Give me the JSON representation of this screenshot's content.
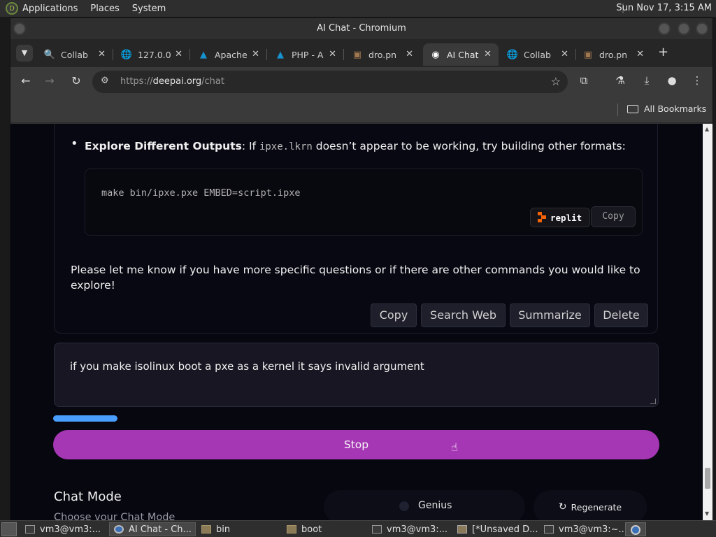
{
  "top_panel": {
    "menus": [
      "Applications",
      "Places",
      "System"
    ],
    "clock": "Sun Nov 17,  3:15 AM"
  },
  "window": {
    "title": "AI Chat - Chromium"
  },
  "tabs": [
    {
      "label": "Collab",
      "icon": "search-icon",
      "active": false
    },
    {
      "label": "127.0.0",
      "icon": "globe-icon",
      "active": false
    },
    {
      "label": "Apache",
      "icon": "arch-logo-icon",
      "active": false
    },
    {
      "label": "PHP - A",
      "icon": "arch-logo-icon",
      "active": false
    },
    {
      "label": "dro.pn",
      "icon": "image-icon",
      "active": false
    },
    {
      "label": "AI Chat",
      "icon": "chromium-icon",
      "active": true
    },
    {
      "label": "Collab",
      "icon": "globe-icon",
      "active": false
    },
    {
      "label": "dro.pn",
      "icon": "image-icon",
      "active": false
    }
  ],
  "toolbar": {
    "url_prefix": "https://",
    "url_host": "deepai.org",
    "url_path": "/chat"
  },
  "bookmarks": {
    "all_label": "All Bookmarks"
  },
  "message": {
    "bullet_bold": "Explore Different Outputs",
    "bullet_pre": ": If ",
    "bullet_code": "ipxe.lkrn",
    "bullet_post": " doesn’t appear to be working, try building other formats:",
    "code": "make bin/ipxe.pxe EMBED=script.ipxe",
    "replit_label": "replit",
    "code_copy_label": "Copy",
    "closing": "Please let me know if you have more specific questions or if there are other commands you would like to explore!",
    "actions": [
      "Copy",
      "Search Web",
      "Summarize",
      "Delete"
    ]
  },
  "input": {
    "value": "if you make isolinux boot a pxe as a kernel it says invalid argument"
  },
  "stop_label": "Stop",
  "chat_mode": {
    "title": "Chat Mode",
    "subtitle": "Choose your Chat Mode",
    "mode_label": "Genius",
    "regenerate_label": "Regenerate"
  },
  "taskbar": [
    {
      "label": "vm3@vm3:...",
      "icon": "terminal-icon",
      "active": false
    },
    {
      "label": "AI Chat - Ch...",
      "icon": "chromium-icon",
      "active": true
    },
    {
      "label": "bin",
      "icon": "folder-icon",
      "active": false
    },
    {
      "label": "boot",
      "icon": "folder-icon",
      "active": false
    },
    {
      "label": "vm3@vm3:...",
      "icon": "terminal-icon",
      "active": false
    },
    {
      "label": "[*Unsaved D...",
      "icon": "text-editor-icon",
      "active": false
    },
    {
      "label": "vm3@vm3:~...",
      "icon": "terminal-icon",
      "active": false
    }
  ]
}
